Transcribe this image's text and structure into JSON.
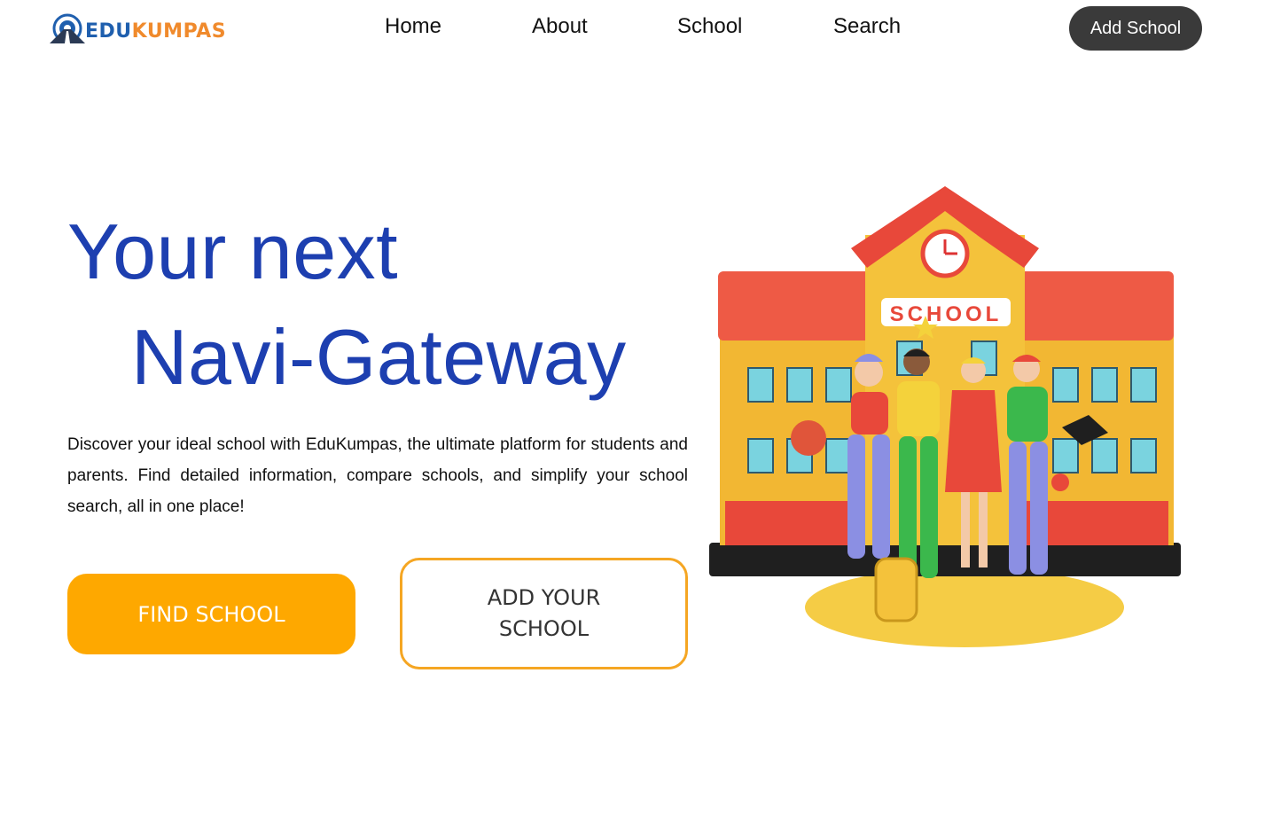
{
  "header": {
    "logo": {
      "part1": "EDU",
      "part2": "KUMPAS"
    },
    "nav": [
      {
        "label": "Home"
      },
      {
        "label": "About"
      },
      {
        "label": "School"
      },
      {
        "label": "Search"
      }
    ],
    "add_school_label": "Add School"
  },
  "hero": {
    "headline_line1": "Your next",
    "headline_line2": "Navi-Gateway",
    "description": "Discover your ideal school with EduKumpas, the ultimate platform for students and parents. Find detailed information, compare schools, and simplify your school search, all in one place!",
    "find_school_label": "FIND SCHOOL",
    "add_your_school_label": "ADD YOUR SCHOOL",
    "illustration": {
      "sign_text": "SCHOOL"
    }
  },
  "colors": {
    "primary_blue": "#1d3fb0",
    "accent_orange": "#fea800",
    "dark_button": "#3a3a3a",
    "logo_blue": "#1f5fae",
    "logo_orange": "#f08a2c"
  }
}
